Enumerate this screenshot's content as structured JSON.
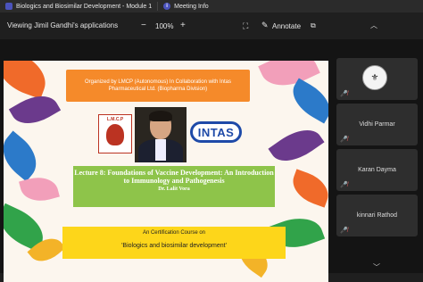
{
  "window": {
    "tab_title": "Biologics and Biosimilar Development - Module 1",
    "meeting_info_label": "Meeting Info"
  },
  "toolbar": {
    "viewing_label": "Viewing Jimil Gandhi's applications",
    "zoom_out": "−",
    "zoom_level": "100%",
    "zoom_in": "+",
    "annotate_label": "Annotate"
  },
  "slide": {
    "organizer_text": "Organized by LMCP (Autonomous) In Collaboration with Intas Pharmaceutical Ltd. (Biopharma Division)",
    "lmcp_logo_text": "L.M.C.P",
    "intas_logo_text": "INTAS",
    "lecture_title": "Lecture 8: Foundations of Vaccine Development: An Introduction to Immunology and Pathogenesis",
    "author": "Dr. Lalit Vora",
    "certification_text": "An Certification Course on",
    "course_name": "'Biologics and biosimilar development'"
  },
  "participants": [
    {
      "name": "",
      "avatar": "institution-emblem",
      "muted": true
    },
    {
      "name": "Vidhi Parmar",
      "muted": true
    },
    {
      "name": "Karan Dayma",
      "muted": true
    },
    {
      "name": "kinnari Rathod",
      "muted": true
    }
  ],
  "colors": {
    "orange_banner": "#f58a2a",
    "green_banner": "#8ec44a",
    "yellow_banner": "#fdd61a",
    "intas_blue": "#1e4aa8",
    "muted_red": "#e05a5a"
  }
}
